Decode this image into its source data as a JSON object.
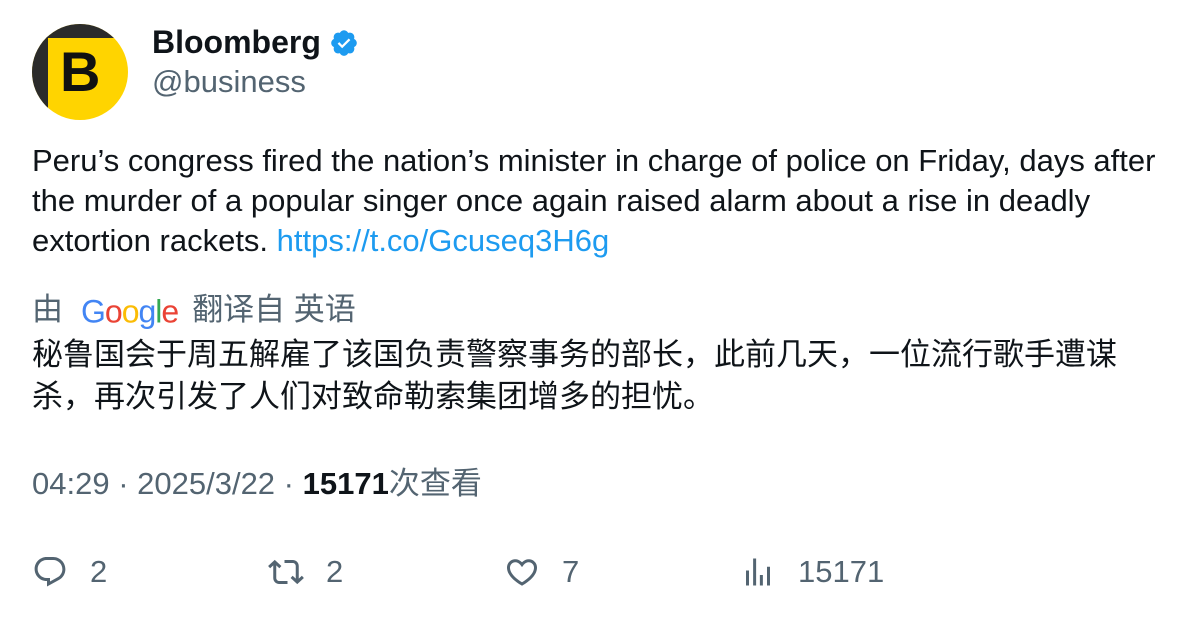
{
  "author": {
    "avatar_letter": "B",
    "name": "Bloomberg",
    "handle": "@business",
    "verified_color": "#1d9bf0"
  },
  "tweet": {
    "text": "Peru’s congress fired the nation’s minister in charge of police on Friday, days after the murder of a popular singer once again raised alarm about a rise in deadly extortion rackets. ",
    "link": "https://t.co/Gcuseq3H6g"
  },
  "translation": {
    "by": "由",
    "provider": [
      "G",
      "o",
      "o",
      "g",
      "l",
      "e"
    ],
    "provider_colors": [
      "#4285f4",
      "#ea4335",
      "#fbbc05",
      "#4285f4",
      "#34a853",
      "#ea4335"
    ],
    "from_label": "翻译自 英语",
    "text": "秘鲁国会于周五解雇了该国负责警察事务的部长，此前几天，一位流行歌手遭谋杀，再次引发了人们对致命勒索集团增多的担忧。"
  },
  "meta": {
    "time": "04:29",
    "sep1": " · ",
    "date": "2025/3/22",
    "sep2": " · ",
    "views": "15171",
    "views_label": "次查看"
  },
  "actions": {
    "replies": "2",
    "retweets": "2",
    "likes": "7",
    "views": "15171"
  }
}
